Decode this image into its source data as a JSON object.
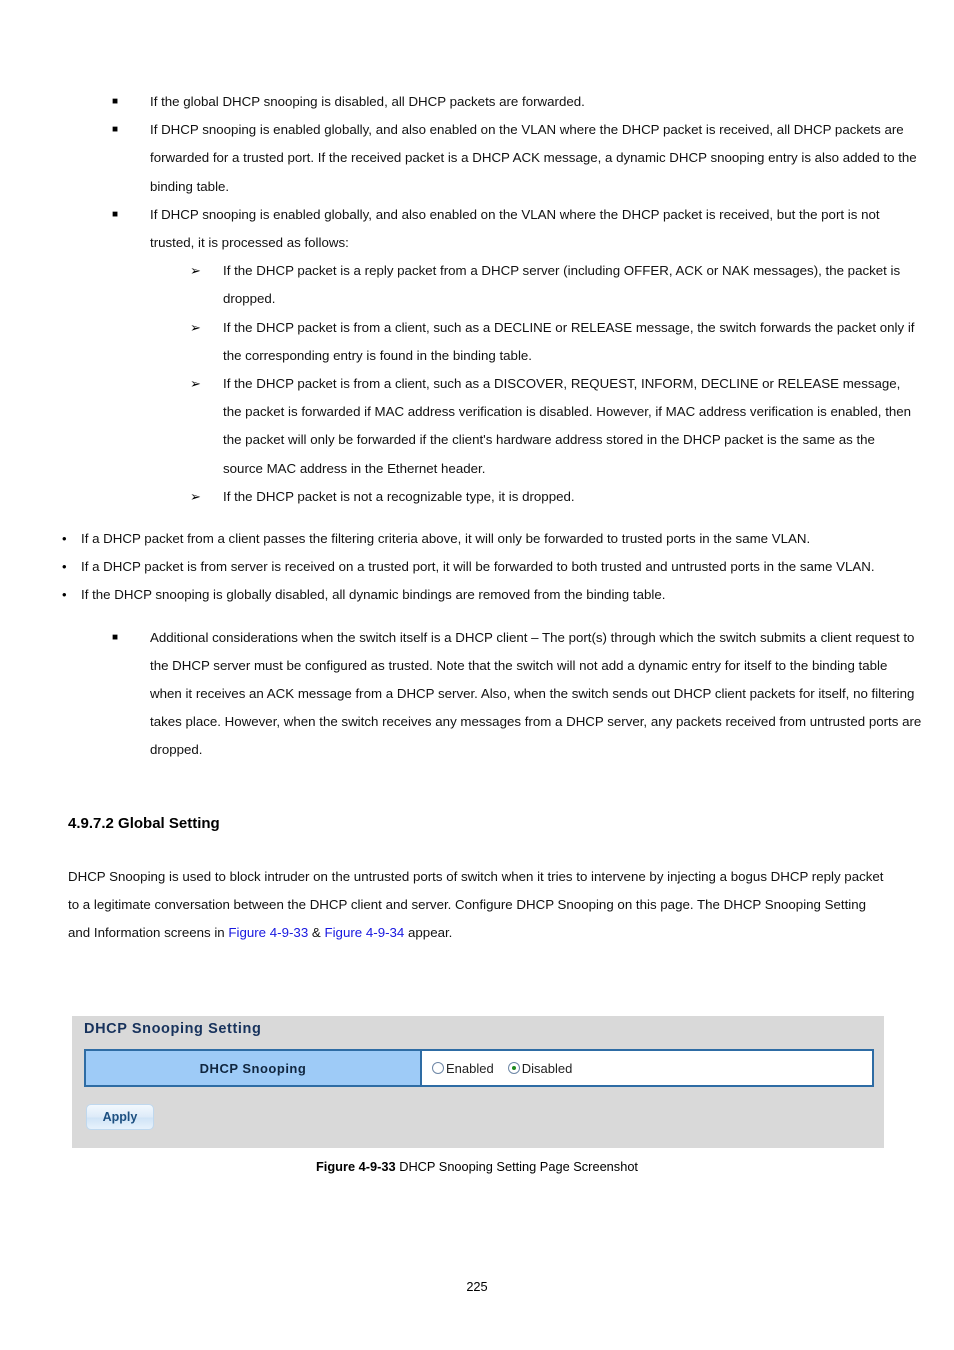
{
  "document": {
    "page_number": "225",
    "section": {
      "heading": "4.9.7.2 Global Setting",
      "paragraph_before_links": "DHCP Snooping is used to block intruder on the untrusted ports of switch when it tries to intervene by injecting a bogus DHCP reply packet to a legitimate conversation between the DHCP client and server. Configure DHCP Snooping on this page. The DHCP Snooping Setting and Information screens in ",
      "link1": "Figure 4-9-33",
      "link_separator": " & ",
      "link2": "Figure 4-9-34",
      "paragraph_after_links": " appear.",
      "link_color": "#1818e0"
    },
    "bullets_square_top": [
      "If the global DHCP snooping is disabled, all DHCP packets are forwarded.",
      "If DHCP snooping is enabled globally, and also enabled on the VLAN where the DHCP packet is received, all DHCP packets are forwarded for a trusted port. If the received packet is a DHCP ACK message, a dynamic DHCP snooping entry is also added to the binding table.",
      "If DHCP snooping is enabled globally, and also enabled on the VLAN where the DHCP packet is received, but the port is not trusted, it is processed as follows:"
    ],
    "bullets_arrow": [
      "If the DHCP packet is a reply packet from a DHCP server (including OFFER, ACK or NAK messages), the packet is dropped.",
      "If the DHCP packet is from a client, such as a DECLINE or RELEASE message, the switch forwards the packet only if the corresponding entry is found in the binding table.",
      "If the DHCP packet is from a client, such as a DISCOVER, REQUEST, INFORM, DECLINE or RELEASE message, the packet is forwarded if MAC address verification is disabled. However, if MAC address verification is enabled, then the packet will only be forwarded if the client's hardware address stored in the DHCP packet is the same as the source MAC address in the Ethernet header.",
      "If the DHCP packet is not a recognizable type, it is dropped."
    ],
    "bullets_dot": [
      "If a DHCP packet from a client passes the filtering criteria above, it will only be forwarded to trusted ports in the same VLAN.",
      "If a DHCP packet is from server is received on a trusted port, it will be forwarded to both trusted and untrusted ports in the same VLAN.",
      "If the DHCP snooping is globally disabled, all dynamic bindings are removed from the binding table."
    ],
    "bullets_square_bottom": [
      "Additional considerations when the switch itself is a DHCP client – The port(s) through which the switch submits a client request to the DHCP server must be configured as trusted. Note that the switch will not add a dynamic entry for itself to the binding table when it receives an ACK message from a DHCP server. Also, when the switch sends out DHCP client packets for itself, no filtering takes place. However, when the switch receives any messages from a DHCP server, any packets received from untrusted ports are dropped."
    ],
    "markers": {
      "square": "■",
      "arrow": "➢",
      "dot": "•"
    },
    "figure_caption": {
      "label": "Figure 4-9-33",
      "text": " DHCP Snooping Setting Page Screenshot"
    }
  },
  "screenshot_panel": {
    "title": "DHCP Snooping Setting",
    "row_label": "DHCP Snooping",
    "radio_options": [
      {
        "label": "Enabled",
        "selected": false
      },
      {
        "label": "Disabled",
        "selected": true
      }
    ],
    "apply_button": "Apply",
    "colors": {
      "panel_background": "#d9d9d9",
      "table_border": "#2e6ca4",
      "label_cell": "#9ecbf7",
      "title_text": "#17325c",
      "radio_selected_dot": "#1f8a1f"
    }
  }
}
